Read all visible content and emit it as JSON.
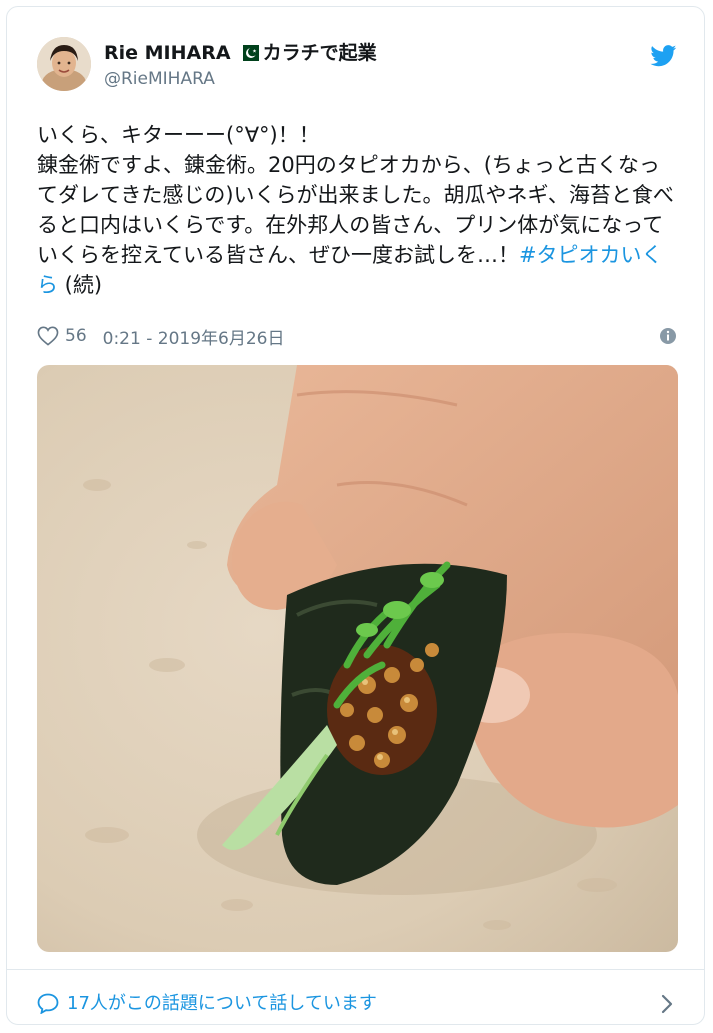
{
  "author": {
    "display_name": "Rie MIHARA",
    "name_suffix": "カラチで起業",
    "handle": "@RieMIHARA"
  },
  "tweet": {
    "text": "いくら、キターーー(°∀°)！！\n錬金術ですよ、錬金術。20円のタピオカから、(ちょっと古くなってダレてきた感じの)いくらが出来ました。胡瓜やネギ、海苔と食べると口内はいくらです。在外邦人の皆さん、プリン体が気になっていくらを控えている皆さん、ぜひ一度お試しを…！",
    "hashtag": "#タピオカいくら",
    "suffix": " (続)"
  },
  "meta": {
    "likes": "56",
    "timestamp": "0:21 - 2019年6月26日"
  },
  "footer": {
    "conversation_text": "17人がこの話題について話しています"
  },
  "icons": {
    "brand": "twitter-bird-icon",
    "like": "heart-icon",
    "info": "info-icon",
    "conversation": "speech-bubble-icon",
    "chevron": "chevron-right-icon",
    "flag": "pakistan-flag-icon"
  },
  "colors": {
    "accent": "#1b95e0",
    "text": "#14171a",
    "secondary": "#657786",
    "border": "#e1e8ed"
  }
}
